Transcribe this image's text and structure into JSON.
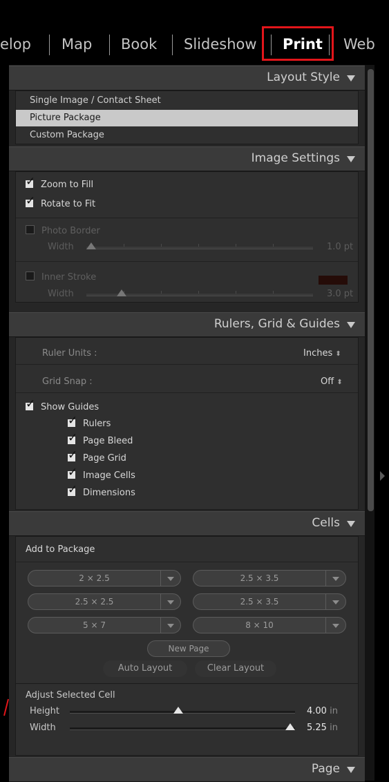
{
  "modules": {
    "items": [
      "elop",
      "Map",
      "Book",
      "Slideshow",
      "Print",
      "Web"
    ],
    "active": "Print",
    "highlight_color": "#e3151a"
  },
  "layout_style": {
    "title": "Layout Style",
    "options": [
      "Single Image / Contact Sheet",
      "Picture Package",
      "Custom Package"
    ],
    "selected": "Picture Package"
  },
  "image_settings": {
    "title": "Image Settings",
    "zoom_to_fill": {
      "label": "Zoom to Fill",
      "checked": true
    },
    "rotate_to_fit": {
      "label": "Rotate to Fit",
      "checked": true
    },
    "photo_border": {
      "label": "Photo Border",
      "checked": false,
      "width_label": "Width",
      "value": "1.0 pt"
    },
    "inner_stroke": {
      "label": "Inner Stroke",
      "checked": false,
      "width_label": "Width",
      "value": "3.0 pt",
      "color": "#250c08"
    }
  },
  "rulers_grid_guides": {
    "title": "Rulers, Grid & Guides",
    "ruler_units": {
      "label": "Ruler Units :",
      "value": "Inches"
    },
    "grid_snap": {
      "label": "Grid Snap :",
      "value": "Off"
    },
    "show_guides": {
      "label": "Show Guides",
      "checked": true
    },
    "guides": [
      {
        "label": "Rulers",
        "checked": true
      },
      {
        "label": "Page Bleed",
        "checked": true
      },
      {
        "label": "Page Grid",
        "checked": true
      },
      {
        "label": "Image Cells",
        "checked": true
      },
      {
        "label": "Dimensions",
        "checked": true
      }
    ]
  },
  "cells": {
    "title": "Cells",
    "add_to_package": "Add to Package",
    "sizes": [
      "2 × 2.5",
      "2.5 × 3.5",
      "2.5 × 2.5",
      "2.5 × 3.5",
      "5 × 7",
      "8 × 10"
    ],
    "new_page": "New Page",
    "auto_layout": "Auto Layout",
    "clear_layout": "Clear Layout",
    "adjust_selected_cell": "Adjust Selected Cell",
    "height": {
      "label": "Height",
      "value": "4.00",
      "unit": "in"
    },
    "width": {
      "label": "Width",
      "value": "5.25",
      "unit": "in"
    }
  },
  "page": {
    "title": "Page"
  }
}
